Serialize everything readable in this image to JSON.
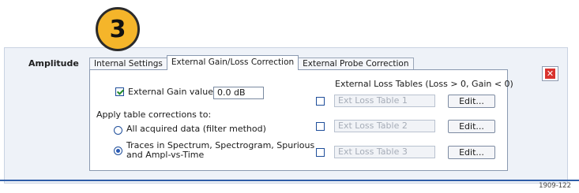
{
  "callout": {
    "number": "3"
  },
  "section": {
    "label": "Amplitude"
  },
  "tabs": [
    {
      "label": "Internal Settings",
      "active": false
    },
    {
      "label": "External Gain/Loss Correction",
      "active": true
    },
    {
      "label": "External Probe Correction",
      "active": false
    }
  ],
  "gain": {
    "checkbox_label": "External Gain value:",
    "value": "0.0 dB",
    "checked": true
  },
  "apply": {
    "heading": "Apply table corrections to:",
    "option_all": "All acquired data (filter method)",
    "option_traces_line1": "Traces in Spectrum, Spectrogram, Spurious",
    "option_traces_line2": "and Ampl-vs-Time",
    "selected": "traces"
  },
  "loss_tables": {
    "heading": "External Loss Tables (Loss > 0, Gain < 0)",
    "rows": [
      {
        "placeholder": "Ext Loss Table 1",
        "edit_label": "Edit..."
      },
      {
        "placeholder": "Ext Loss Table 2",
        "edit_label": "Edit..."
      },
      {
        "placeholder": "Ext Loss Table 3",
        "edit_label": "Edit..."
      }
    ]
  },
  "figure_id": "1909-122",
  "colors": {
    "accent_blue": "#2e5da8",
    "callout_orange": "#f5b52a",
    "close_red": "#d9332e"
  }
}
